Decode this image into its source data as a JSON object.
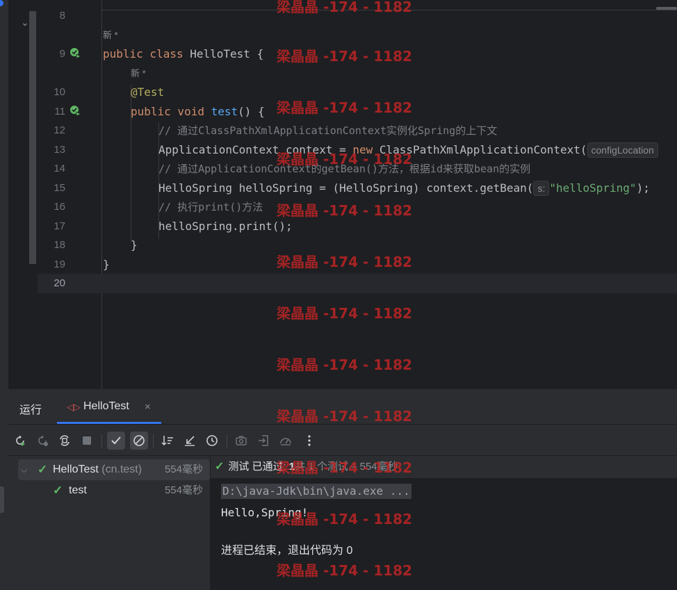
{
  "editor": {
    "lines": [
      {
        "num": "8"
      },
      {
        "num": "9"
      },
      {
        "num": "10"
      },
      {
        "num": "11"
      },
      {
        "num": "12"
      },
      {
        "num": "13"
      },
      {
        "num": "14"
      },
      {
        "num": "15"
      },
      {
        "num": "16"
      },
      {
        "num": "17"
      },
      {
        "num": "18"
      },
      {
        "num": "19"
      },
      {
        "num": "20"
      }
    ],
    "hint_new": "新 *",
    "code": {
      "l9_kw": "public class ",
      "l9_name": "HelloTest {",
      "l10_ann": "@Test",
      "l11_kw": "public void ",
      "l11_fn": "test",
      "l11_rest": "() {",
      "l12_cm": "// 通过ClassPathXmlApplicationContext实例化Spring的上下文",
      "l13_a": "ApplicationContext context = ",
      "l13_kw": "new ",
      "l13_b": "ClassPathXmlApplicationContext(",
      "l13_hint": "configLocation",
      "l14_cm": "// 通过ApplicationContext的getBean()方法，根据id来获取bean的实例",
      "l15_a": "HelloSpring helloSpring = (HelloSpring) context.getBean(",
      "l15_hint": "s:",
      "l15_str": "\"helloSpring\"",
      "l15_end": ");",
      "l16_cm": "// 执行print()方法",
      "l17": "helloSpring.print();",
      "l18": "}",
      "l19": "}"
    }
  },
  "run_panel": {
    "title": "运行",
    "tab_label": "HelloTest",
    "tab_close": "×",
    "tree": {
      "root_name": "HelloTest",
      "root_pkg": "(cn.test)",
      "root_time": "554毫秒",
      "child_name": "test",
      "child_time": "554毫秒"
    },
    "status": {
      "prefix": "测试 已通过:",
      "count_bold": "1",
      "suffix": "共 1 个测试 – 554毫秒"
    },
    "console": {
      "cmd": "D:\\java-Jdk\\bin\\java.exe ...",
      "out": "Hello,Spring!",
      "exit": "进程已结束，退出代码为 0"
    }
  },
  "watermark": "梁晶晶 -174 - 1182",
  "colors": {
    "keyword": "#cf8e6d",
    "function": "#56a8f5",
    "annotation": "#b3ae60",
    "comment": "#7a7e85",
    "string": "#6aab73",
    "pass": "#5fb865",
    "watermark": "#c42525"
  },
  "icons": {
    "gutter_run": "run-test-passed-icon",
    "toolbar": [
      "rerun-icon",
      "rerun-failed-icon",
      "toggle-auto-test-icon",
      "stop-icon",
      "show-passed-icon",
      "show-ignored-icon",
      "sort-icon",
      "collapse-icon",
      "history-icon",
      "camera-icon",
      "import-icon",
      "coverage-icon",
      "more-icon"
    ]
  }
}
